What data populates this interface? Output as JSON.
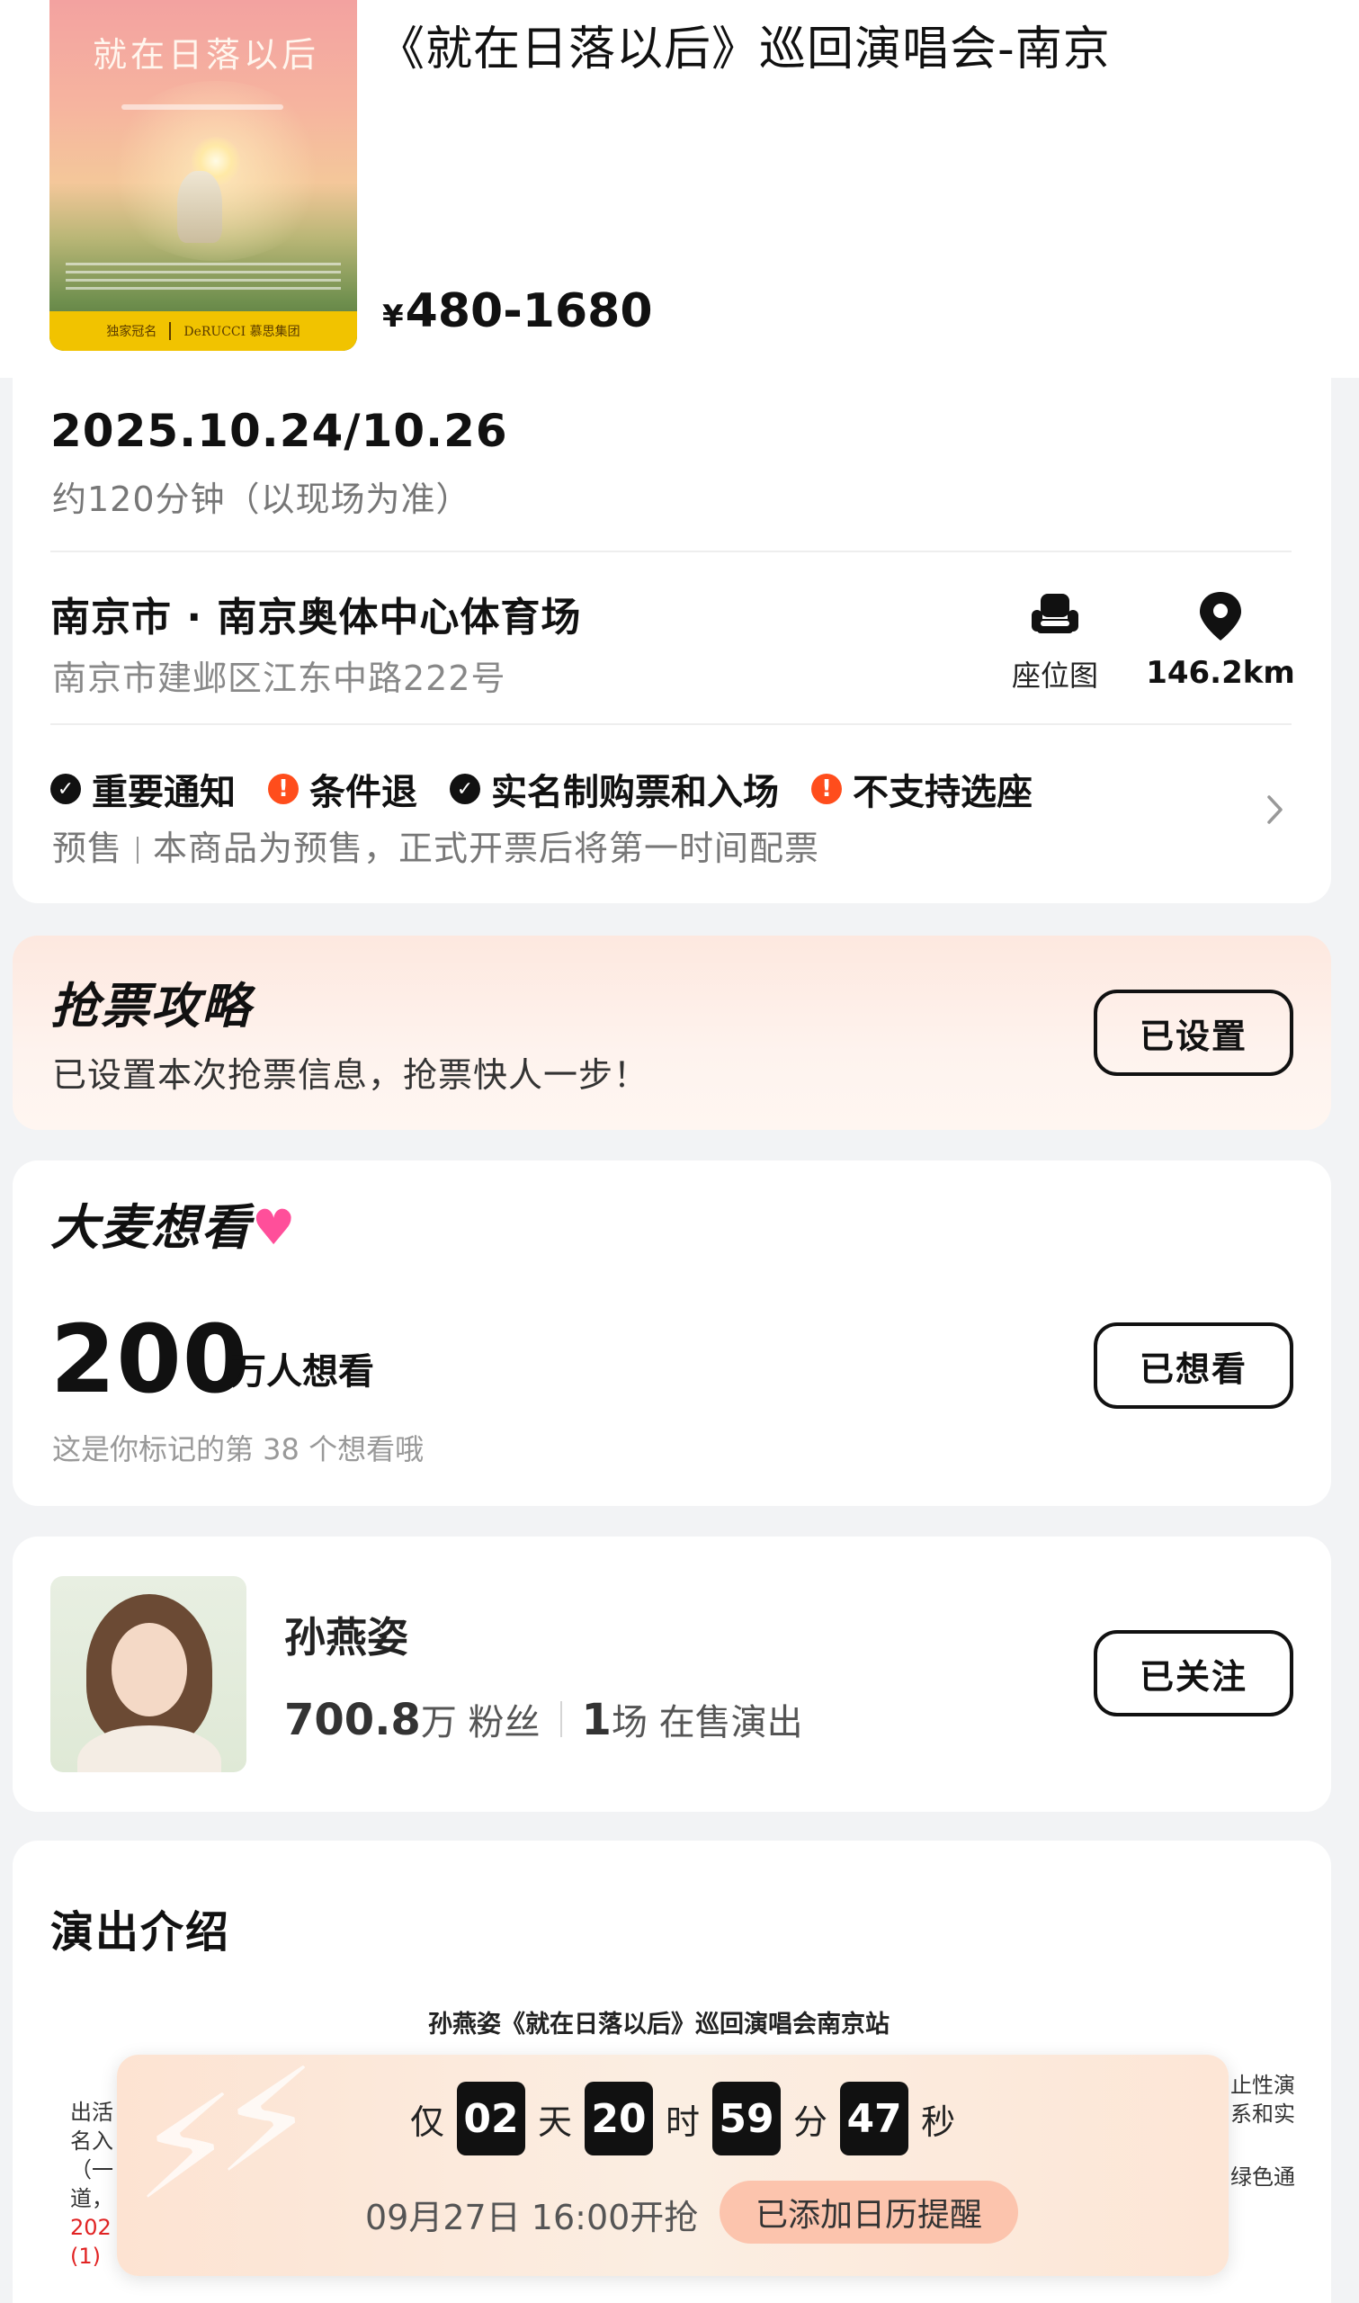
{
  "header": {
    "poster_title": "就在日落以后",
    "poster_sponsor_left": "独家冠名",
    "poster_sponsor_right": "DeRUCCI 慕思集团",
    "title": "《就在日落以后》巡回演唱会-南京",
    "price_symbol": "¥",
    "price_range": "480-1680"
  },
  "info": {
    "date": "2025.10.24/10.26",
    "duration": "约120分钟（以现场为准）",
    "venue": "南京市 · 南京奥体中心体育场",
    "address": "南京市建邺区江东中路222号",
    "seat_map_label": "座位图",
    "distance": "146.2km",
    "notices": [
      {
        "label": "重要通知",
        "type": "check"
      },
      {
        "label": "条件退",
        "type": "warn"
      },
      {
        "label": "实名制购票和入场",
        "type": "check"
      },
      {
        "label": "不支持选座",
        "type": "warn"
      }
    ],
    "presale_tag": "预售",
    "presale_text": "本商品为预售，正式开票后将第一时间配票"
  },
  "grab": {
    "title": "抢票攻略",
    "subtitle": "已设置本次抢票信息，抢票快人一步！",
    "button": "已设置"
  },
  "want": {
    "title_prefix": "大麦想",
    "title_suffix": "看",
    "count": "200",
    "unit": "万人想看",
    "note": "这是你标记的第 38 个想看哦",
    "button": "已想看"
  },
  "artist": {
    "name": "孙燕姿",
    "fans_num": "700.8",
    "fans_unit": "万 粉丝",
    "shows_num": "1",
    "shows_unit": "场 在售演出",
    "button": "已关注"
  },
  "intro": {
    "title": "演出介绍",
    "doc_title": "孙燕姿《就在日落以后》巡回演唱会南京站",
    "doc_left_lines": [
      "出活",
      "名入",
      "（一",
      "道，",
      "202",
      "(1)"
    ],
    "doc_right_lines": [
      "止性演",
      "系和实"
    ],
    "doc_right_line3": "绿色通"
  },
  "countdown": {
    "prefix": "仅",
    "days": "02",
    "days_unit": "天",
    "hours": "20",
    "hours_unit": "时",
    "minutes": "59",
    "minutes_unit": "分",
    "seconds": "47",
    "seconds_unit": "秒",
    "start_time": "09月27日 16:00开抢",
    "reminder": "已添加日历提醒"
  },
  "colors": {
    "warn": "#ff4d1c",
    "heart": "#ff4f9a",
    "reminder_bg": "#fcc4ad"
  }
}
